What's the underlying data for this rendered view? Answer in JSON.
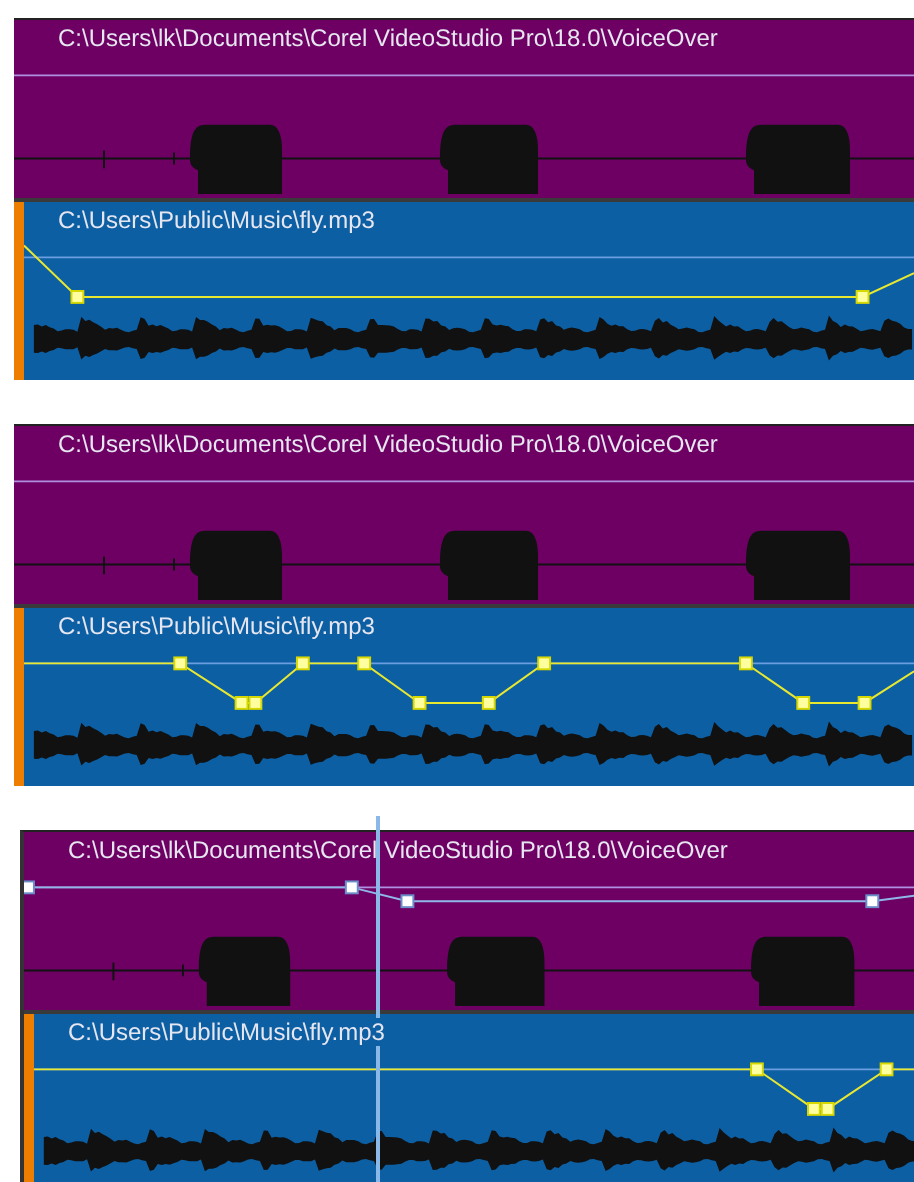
{
  "panels": [
    {
      "tracks": [
        {
          "kind": "voice",
          "title": "C:\\Users\\lk\\Documents\\Corel VideoStudio Pro\\18.0\\VoiceOver"
        },
        {
          "kind": "music",
          "title": "C:\\Users\\Public\\Music\\fly.mp3"
        }
      ]
    },
    {
      "tracks": [
        {
          "kind": "voice",
          "title": "C:\\Users\\lk\\Documents\\Corel VideoStudio Pro\\18.0\\VoiceOver"
        },
        {
          "kind": "music",
          "title": "C:\\Users\\Public\\Music\\fly.mp3"
        }
      ]
    },
    {
      "tracks": [
        {
          "kind": "voice",
          "title": "C:\\Users\\lk\\Documents\\Corel VideoStudio Pro\\18.0\\VoiceOver"
        },
        {
          "kind": "music",
          "title": "C:\\Users\\Public\\Music\\fly.mp3"
        }
      ]
    }
  ]
}
